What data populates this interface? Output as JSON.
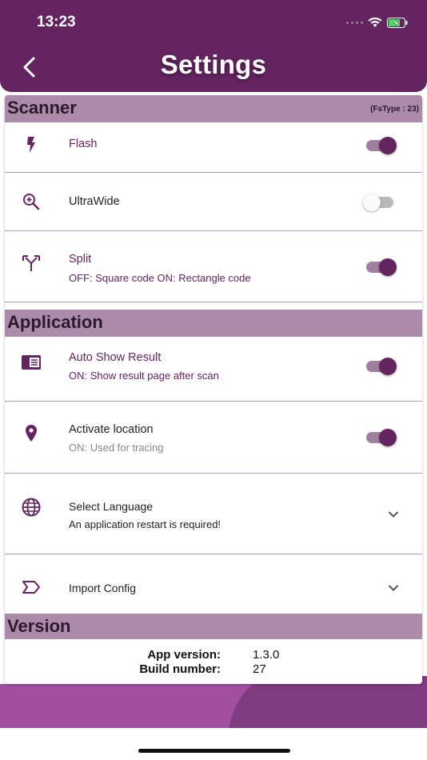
{
  "status_bar": {
    "time": "13:23"
  },
  "header": {
    "title": "Settings"
  },
  "sections": {
    "scanner": {
      "title": "Scanner",
      "extra": "(FsType : 23)"
    },
    "application": {
      "title": "Application"
    },
    "version": {
      "title": "Version"
    }
  },
  "scanner_items": [
    {
      "label": "Flash",
      "toggle": "on"
    },
    {
      "label": "UltraWide",
      "toggle": "off"
    },
    {
      "label": "Split",
      "sub": "OFF: Square code ON: Rectangle code",
      "toggle": "on"
    }
  ],
  "application_items": [
    {
      "label": "Auto Show Result",
      "sub": "ON: Show result page after scan",
      "toggle": "on"
    },
    {
      "label": "Activate location",
      "sub": "ON: Used for tracing",
      "toggle": "on"
    },
    {
      "label": "Select Language",
      "sub": "An application restart is required!"
    },
    {
      "label": "Import Config"
    }
  ],
  "version": {
    "app_version_label": "App version:",
    "app_version": "1.3.0",
    "build_label": "Build number:",
    "build": "27"
  },
  "colors": {
    "primary": "#63245f",
    "section_header": "#ab8aaa",
    "toggle_track_on": "#a07fa0",
    "background_lower": "#a24fa0"
  }
}
